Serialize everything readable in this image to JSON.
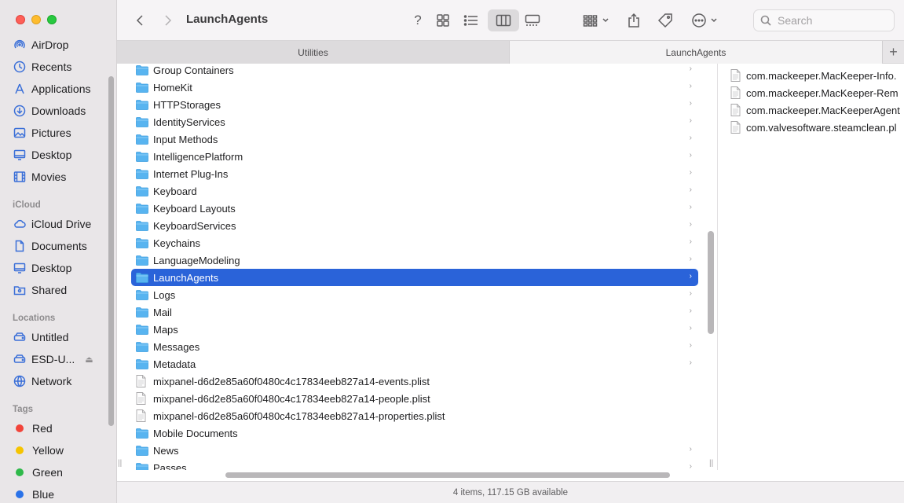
{
  "window": {
    "title": "LaunchAgents"
  },
  "sidebar": {
    "favorites": [
      {
        "label": "AirDrop",
        "icon": "airdrop-icon"
      },
      {
        "label": "Recents",
        "icon": "clock-icon"
      },
      {
        "label": "Applications",
        "icon": "applications-icon"
      },
      {
        "label": "Downloads",
        "icon": "download-icon"
      },
      {
        "label": "Pictures",
        "icon": "photo-icon"
      },
      {
        "label": "Desktop",
        "icon": "desktop-icon"
      },
      {
        "label": "Movies",
        "icon": "film-icon"
      }
    ],
    "icloud_header": "iCloud",
    "icloud": [
      {
        "label": "iCloud Drive",
        "icon": "cloud-icon"
      },
      {
        "label": "Documents",
        "icon": "document-icon"
      },
      {
        "label": "Desktop",
        "icon": "desktop-icon"
      },
      {
        "label": "Shared",
        "icon": "shared-folder-icon"
      }
    ],
    "locations_header": "Locations",
    "locations": [
      {
        "label": "Untitled",
        "icon": "drive-icon"
      },
      {
        "label": "ESD-U...",
        "icon": "drive-icon"
      },
      {
        "label": "Network",
        "icon": "network-icon"
      }
    ],
    "tags_header": "Tags",
    "tags": [
      {
        "label": "Red",
        "color": "#f2443a"
      },
      {
        "label": "Yellow",
        "color": "#f5c400"
      },
      {
        "label": "Green",
        "color": "#2fb94a"
      },
      {
        "label": "Blue",
        "color": "#2a72e8"
      }
    ]
  },
  "toolbar": {
    "search_placeholder": "Search"
  },
  "tabs": [
    {
      "label": "Utilities"
    },
    {
      "label": "LaunchAgents"
    }
  ],
  "column1": {
    "items": [
      {
        "name": "Group Containers",
        "type": "folder"
      },
      {
        "name": "HomeKit",
        "type": "folder"
      },
      {
        "name": "HTTPStorages",
        "type": "folder"
      },
      {
        "name": "IdentityServices",
        "type": "folder"
      },
      {
        "name": "Input Methods",
        "type": "folder"
      },
      {
        "name": "IntelligencePlatform",
        "type": "folder"
      },
      {
        "name": "Internet Plug-Ins",
        "type": "folder"
      },
      {
        "name": "Keyboard",
        "type": "folder"
      },
      {
        "name": "Keyboard Layouts",
        "type": "folder"
      },
      {
        "name": "KeyboardServices",
        "type": "folder"
      },
      {
        "name": "Keychains",
        "type": "folder"
      },
      {
        "name": "LanguageModeling",
        "type": "folder"
      },
      {
        "name": "LaunchAgents",
        "type": "folder",
        "selected": true
      },
      {
        "name": "Logs",
        "type": "folder"
      },
      {
        "name": "Mail",
        "type": "folder"
      },
      {
        "name": "Maps",
        "type": "folder"
      },
      {
        "name": "Messages",
        "type": "folder"
      },
      {
        "name": "Metadata",
        "type": "folder"
      },
      {
        "name": "mixpanel-d6d2e85a60f0480c4c17834eeb827a14-events.plist",
        "type": "file"
      },
      {
        "name": "mixpanel-d6d2e85a60f0480c4c17834eeb827a14-people.plist",
        "type": "file"
      },
      {
        "name": "mixpanel-d6d2e85a60f0480c4c17834eeb827a14-properties.plist",
        "type": "file"
      },
      {
        "name": "Mobile Documents",
        "type": "folder-nochev"
      },
      {
        "name": "News",
        "type": "folder"
      },
      {
        "name": "Passes",
        "type": "folder"
      }
    ]
  },
  "column2": {
    "items": [
      {
        "name": "com.mackeeper.MacKeeper-Info."
      },
      {
        "name": "com.mackeeper.MacKeeper-Rem"
      },
      {
        "name": "com.mackeeper.MacKeeperAgent"
      },
      {
        "name": "com.valvesoftware.steamclean.pl"
      }
    ]
  },
  "status": {
    "text": "4 items, 117.15 GB available"
  }
}
